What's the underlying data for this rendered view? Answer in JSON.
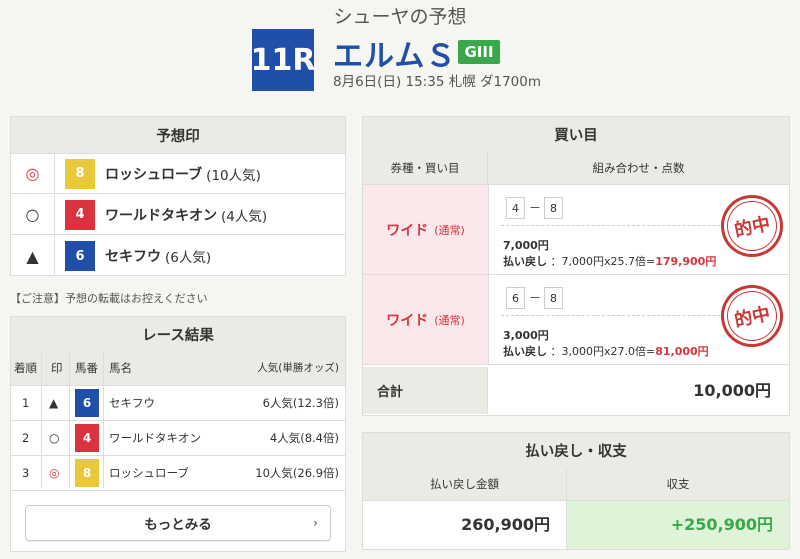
{
  "header": {
    "forecaster": "シューヤの予想",
    "race_no": "11R",
    "race_name": "エルムＳ",
    "grade": "GIII",
    "info": "8月6日(日) 15:35 札幌 ダ1700m"
  },
  "forecast": {
    "title": "予想印",
    "rows": [
      {
        "mark": "◎",
        "num": "8",
        "name": "ロッシュローブ",
        "pop": "(10人気)"
      },
      {
        "mark": "○",
        "num": "4",
        "name": "ワールドタキオン",
        "pop": "(4人気)"
      },
      {
        "mark": "▲",
        "num": "6",
        "name": "セキフウ",
        "pop": "(6人気)"
      }
    ]
  },
  "notice": "【ご注意】予想の転載はお控えください",
  "result": {
    "title": "レース結果",
    "headers": {
      "rank": "着順",
      "mark": "印",
      "num": "馬番",
      "name": "馬名",
      "pop": "人気(単勝オッズ)"
    },
    "rows": [
      {
        "rank": "1",
        "mark": "▲",
        "num": "6",
        "name": "セキフウ",
        "pop": "6人気(12.3倍)"
      },
      {
        "rank": "2",
        "mark": "○",
        "num": "4",
        "name": "ワールドタキオン",
        "pop": "4人気(8.4倍)"
      },
      {
        "rank": "3",
        "mark": "◎",
        "num": "8",
        "name": "ロッシュローブ",
        "pop": "10人気(26.9倍)"
      }
    ],
    "more_label": "もっとみる"
  },
  "bets": {
    "title": "買い目",
    "headers": {
      "type": "券種・買い目",
      "combo": "組み合わせ・点数"
    },
    "rows": [
      {
        "type": "ワイド",
        "sub": "(通常)",
        "a": "4",
        "b": "8",
        "amount": "7,000円",
        "pay_label": "払い戻し",
        "pay_calc": "：7,000円x25.7倍=",
        "pay_result": "179,900円",
        "stamp": "的中"
      },
      {
        "type": "ワイド",
        "sub": "(通常)",
        "a": "6",
        "b": "8",
        "amount": "3,000円",
        "pay_label": "払い戻し",
        "pay_calc": "：3,000円x27.0倍=",
        "pay_result": "81,000円",
        "stamp": "的中"
      }
    ],
    "dash": "－",
    "total_label": "合計",
    "total_value": "10,000円"
  },
  "payout": {
    "title": "払い戻し・収支",
    "headers": {
      "payout": "払い戻し金額",
      "balance": "収支"
    },
    "payout_value": "260,900円",
    "balance_value": "+250,900円"
  },
  "colors": {
    "blue": "#1f4fa8",
    "red": "#d9343e",
    "yellow": "#e9c83a",
    "green": "#3aa84a"
  }
}
